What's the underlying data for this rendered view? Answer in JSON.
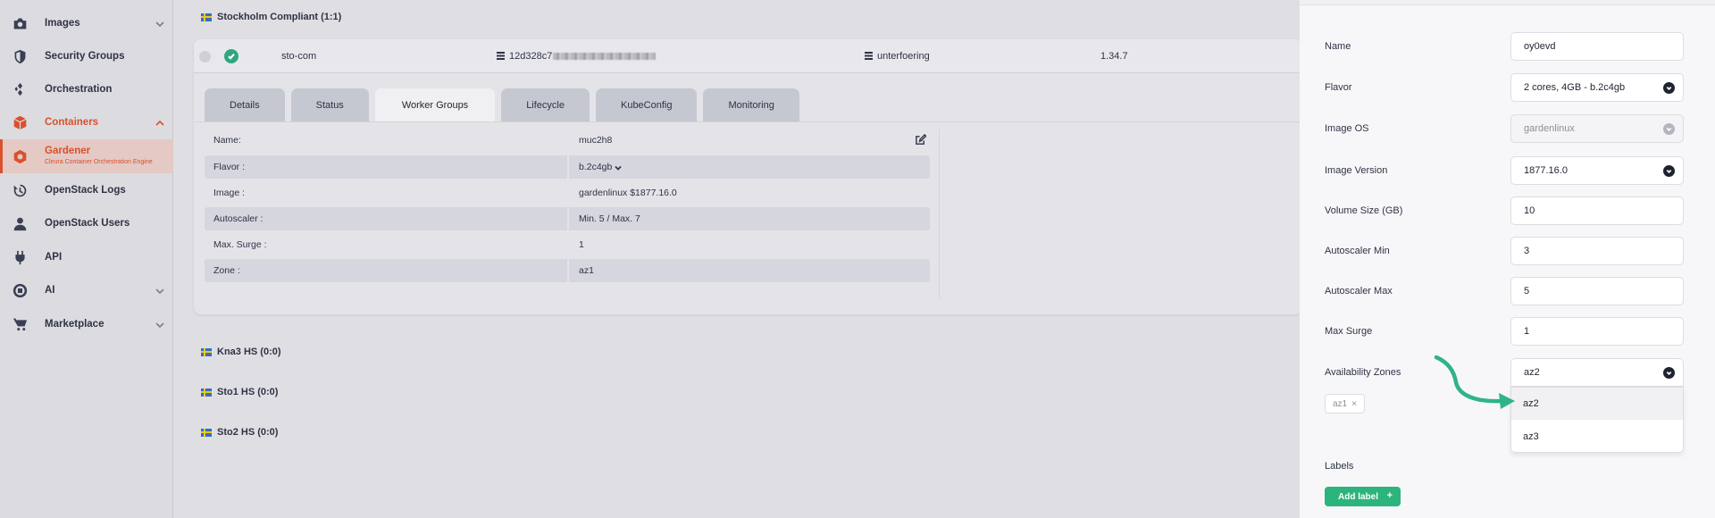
{
  "sidebar": {
    "items": [
      {
        "label": "Images",
        "icon": "camera-icon",
        "chevron": "down"
      },
      {
        "label": "Security Groups",
        "icon": "shield-icon"
      },
      {
        "label": "Orchestration",
        "icon": "orchestration-icon"
      },
      {
        "label": "Containers",
        "icon": "box-icon",
        "chevron": "up"
      },
      {
        "label": "Gardener",
        "sub": "Cleura Container Orchestration Engine",
        "icon": "gardener-icon"
      },
      {
        "label": "OpenStack Logs",
        "icon": "history-icon"
      },
      {
        "label": "OpenStack Users",
        "icon": "user-icon"
      },
      {
        "label": "API",
        "icon": "plug-icon"
      },
      {
        "label": "AI",
        "icon": "ai-icon",
        "chevron": "down"
      },
      {
        "label": "Marketplace",
        "icon": "cart-icon",
        "chevron": "down"
      }
    ],
    "accent_color": "#d9512c"
  },
  "main": {
    "region_title": "Stockholm Compliant (1:1)",
    "cluster": {
      "name": "sto-com",
      "id_prefix": "12d328c7",
      "project": "unterfoering",
      "version": "1.34.7",
      "status_color": "#2fa77e"
    },
    "tabs": [
      "Details",
      "Status",
      "Worker Groups",
      "Lifecycle",
      "KubeConfig",
      "Monitoring"
    ],
    "active_tab": "Worker Groups",
    "worker_group": [
      {
        "label": "Name:",
        "value": "muc2h8"
      },
      {
        "label": "Flavor :",
        "value": "b.2c4gb"
      },
      {
        "label": "Image :",
        "value": "gardenlinux $1877.16.0"
      },
      {
        "label": "Autoscaler :",
        "value": "Min. 5 / Max. 7"
      },
      {
        "label": "Max. Surge :",
        "value": "1"
      },
      {
        "label": "Zone :",
        "value": "az1"
      }
    ],
    "other_regions": [
      "Kna3 HS (0:0)",
      "Sto1 HS (0:0)",
      "Sto2 HS (0:0)"
    ]
  },
  "panel": {
    "fields": {
      "name": {
        "label": "Name",
        "value": "oy0evd"
      },
      "flavor": {
        "label": "Flavor",
        "value": "2 cores, 4GB - b.2c4gb"
      },
      "image_os": {
        "label": "Image OS",
        "value": "gardenlinux"
      },
      "image_version": {
        "label": "Image Version",
        "value": "1877.16.0"
      },
      "volume_size": {
        "label": "Volume Size (GB)",
        "value": "10"
      },
      "autoscaler_min": {
        "label": "Autoscaler Min",
        "value": "3"
      },
      "autoscaler_max": {
        "label": "Autoscaler Max",
        "value": "5"
      },
      "max_surge": {
        "label": "Max Surge",
        "value": "1"
      },
      "zones": {
        "label": "Availability Zones",
        "value": "az2"
      }
    },
    "zone_options": [
      "az2",
      "az3"
    ],
    "selected_zone_chip": "az1",
    "chip_remove": "×",
    "labels_title": "Labels",
    "add_label_button": "Add label",
    "add_label_plus": "+",
    "button_color": "#2db37c",
    "arrow_color": "#2fb38a"
  }
}
